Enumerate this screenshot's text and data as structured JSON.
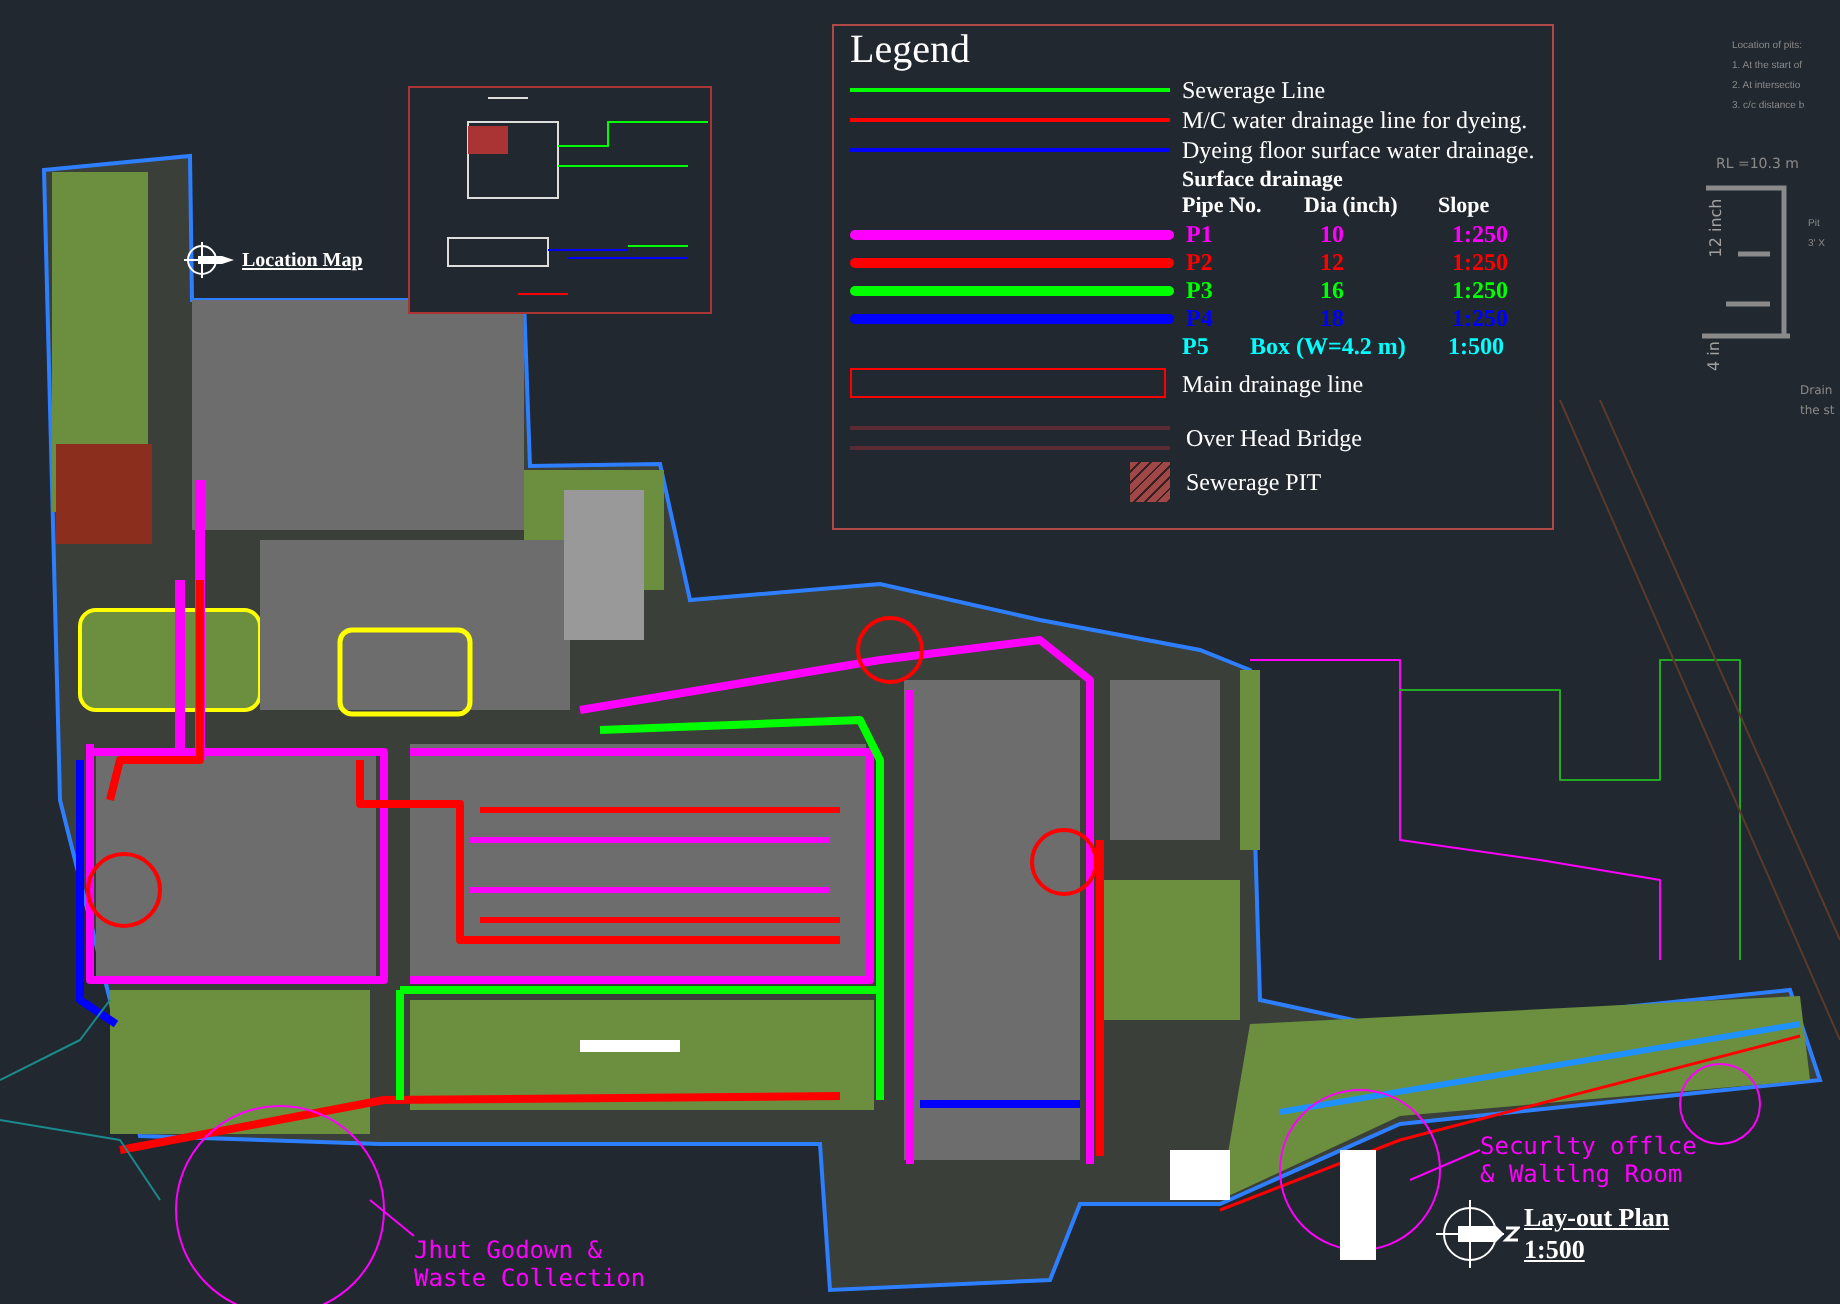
{
  "legend": {
    "title": "Legend",
    "line_items": [
      {
        "kind": "thin",
        "color": "#00ff00",
        "label": "Sewerage Line"
      },
      {
        "kind": "thin",
        "color": "#ff0000",
        "label": "M/C water drainage line for dyeing."
      },
      {
        "kind": "thin",
        "color": "#0000ff",
        "label": "Dyeing  floor surface water drainage."
      }
    ],
    "surface_drainage": {
      "heading": "Surface drainage",
      "columns": [
        "Pipe No.",
        "Dia (inch)",
        "Slope"
      ],
      "rows": [
        {
          "kind": "bar",
          "color": "#ff00ff",
          "pipe": "P1",
          "dia": "10",
          "slope": "1:250"
        },
        {
          "kind": "bar",
          "color": "#ff0000",
          "pipe": "P2",
          "dia": "12",
          "slope": "1:250"
        },
        {
          "kind": "bar",
          "color": "#00ff00",
          "pipe": "P3",
          "dia": "16",
          "slope": "1:250"
        },
        {
          "kind": "bar",
          "color": "#0000ff",
          "pipe": "P4",
          "dia": "18",
          "slope": "1:250"
        },
        {
          "kind": "none",
          "color": "#00ffff",
          "pipe": "P5",
          "dia": "Box (W=4.2 m)",
          "slope": "1:500"
        }
      ]
    },
    "other_items": [
      {
        "kind": "box",
        "label": "Main drainage line"
      },
      {
        "kind": "double",
        "label": "Over Head Bridge"
      },
      {
        "kind": "hatch",
        "label": "Sewerage PIT"
      }
    ]
  },
  "location_map": {
    "label": "Location Map"
  },
  "pit_notes": {
    "title": "Location of pits:",
    "items": [
      "1. At the start of",
      "2. At intersectio",
      "3. c/c distance b"
    ],
    "level_label": "RL =10.3 m",
    "dim_top": "12 inch",
    "dim_bottom": "4 in",
    "pit_text": [
      "Pit",
      "3' X"
    ],
    "drain_text": [
      "Drain",
      "the st"
    ]
  },
  "annotations": [
    {
      "lines": [
        "Jhut Godown &",
        "Waste Collection"
      ]
    },
    {
      "lines": [
        "Securlty offlce",
        "& Waltlng Room"
      ]
    }
  ],
  "plan_title": {
    "title": "Lay-out Plan",
    "scale": "1:500"
  }
}
